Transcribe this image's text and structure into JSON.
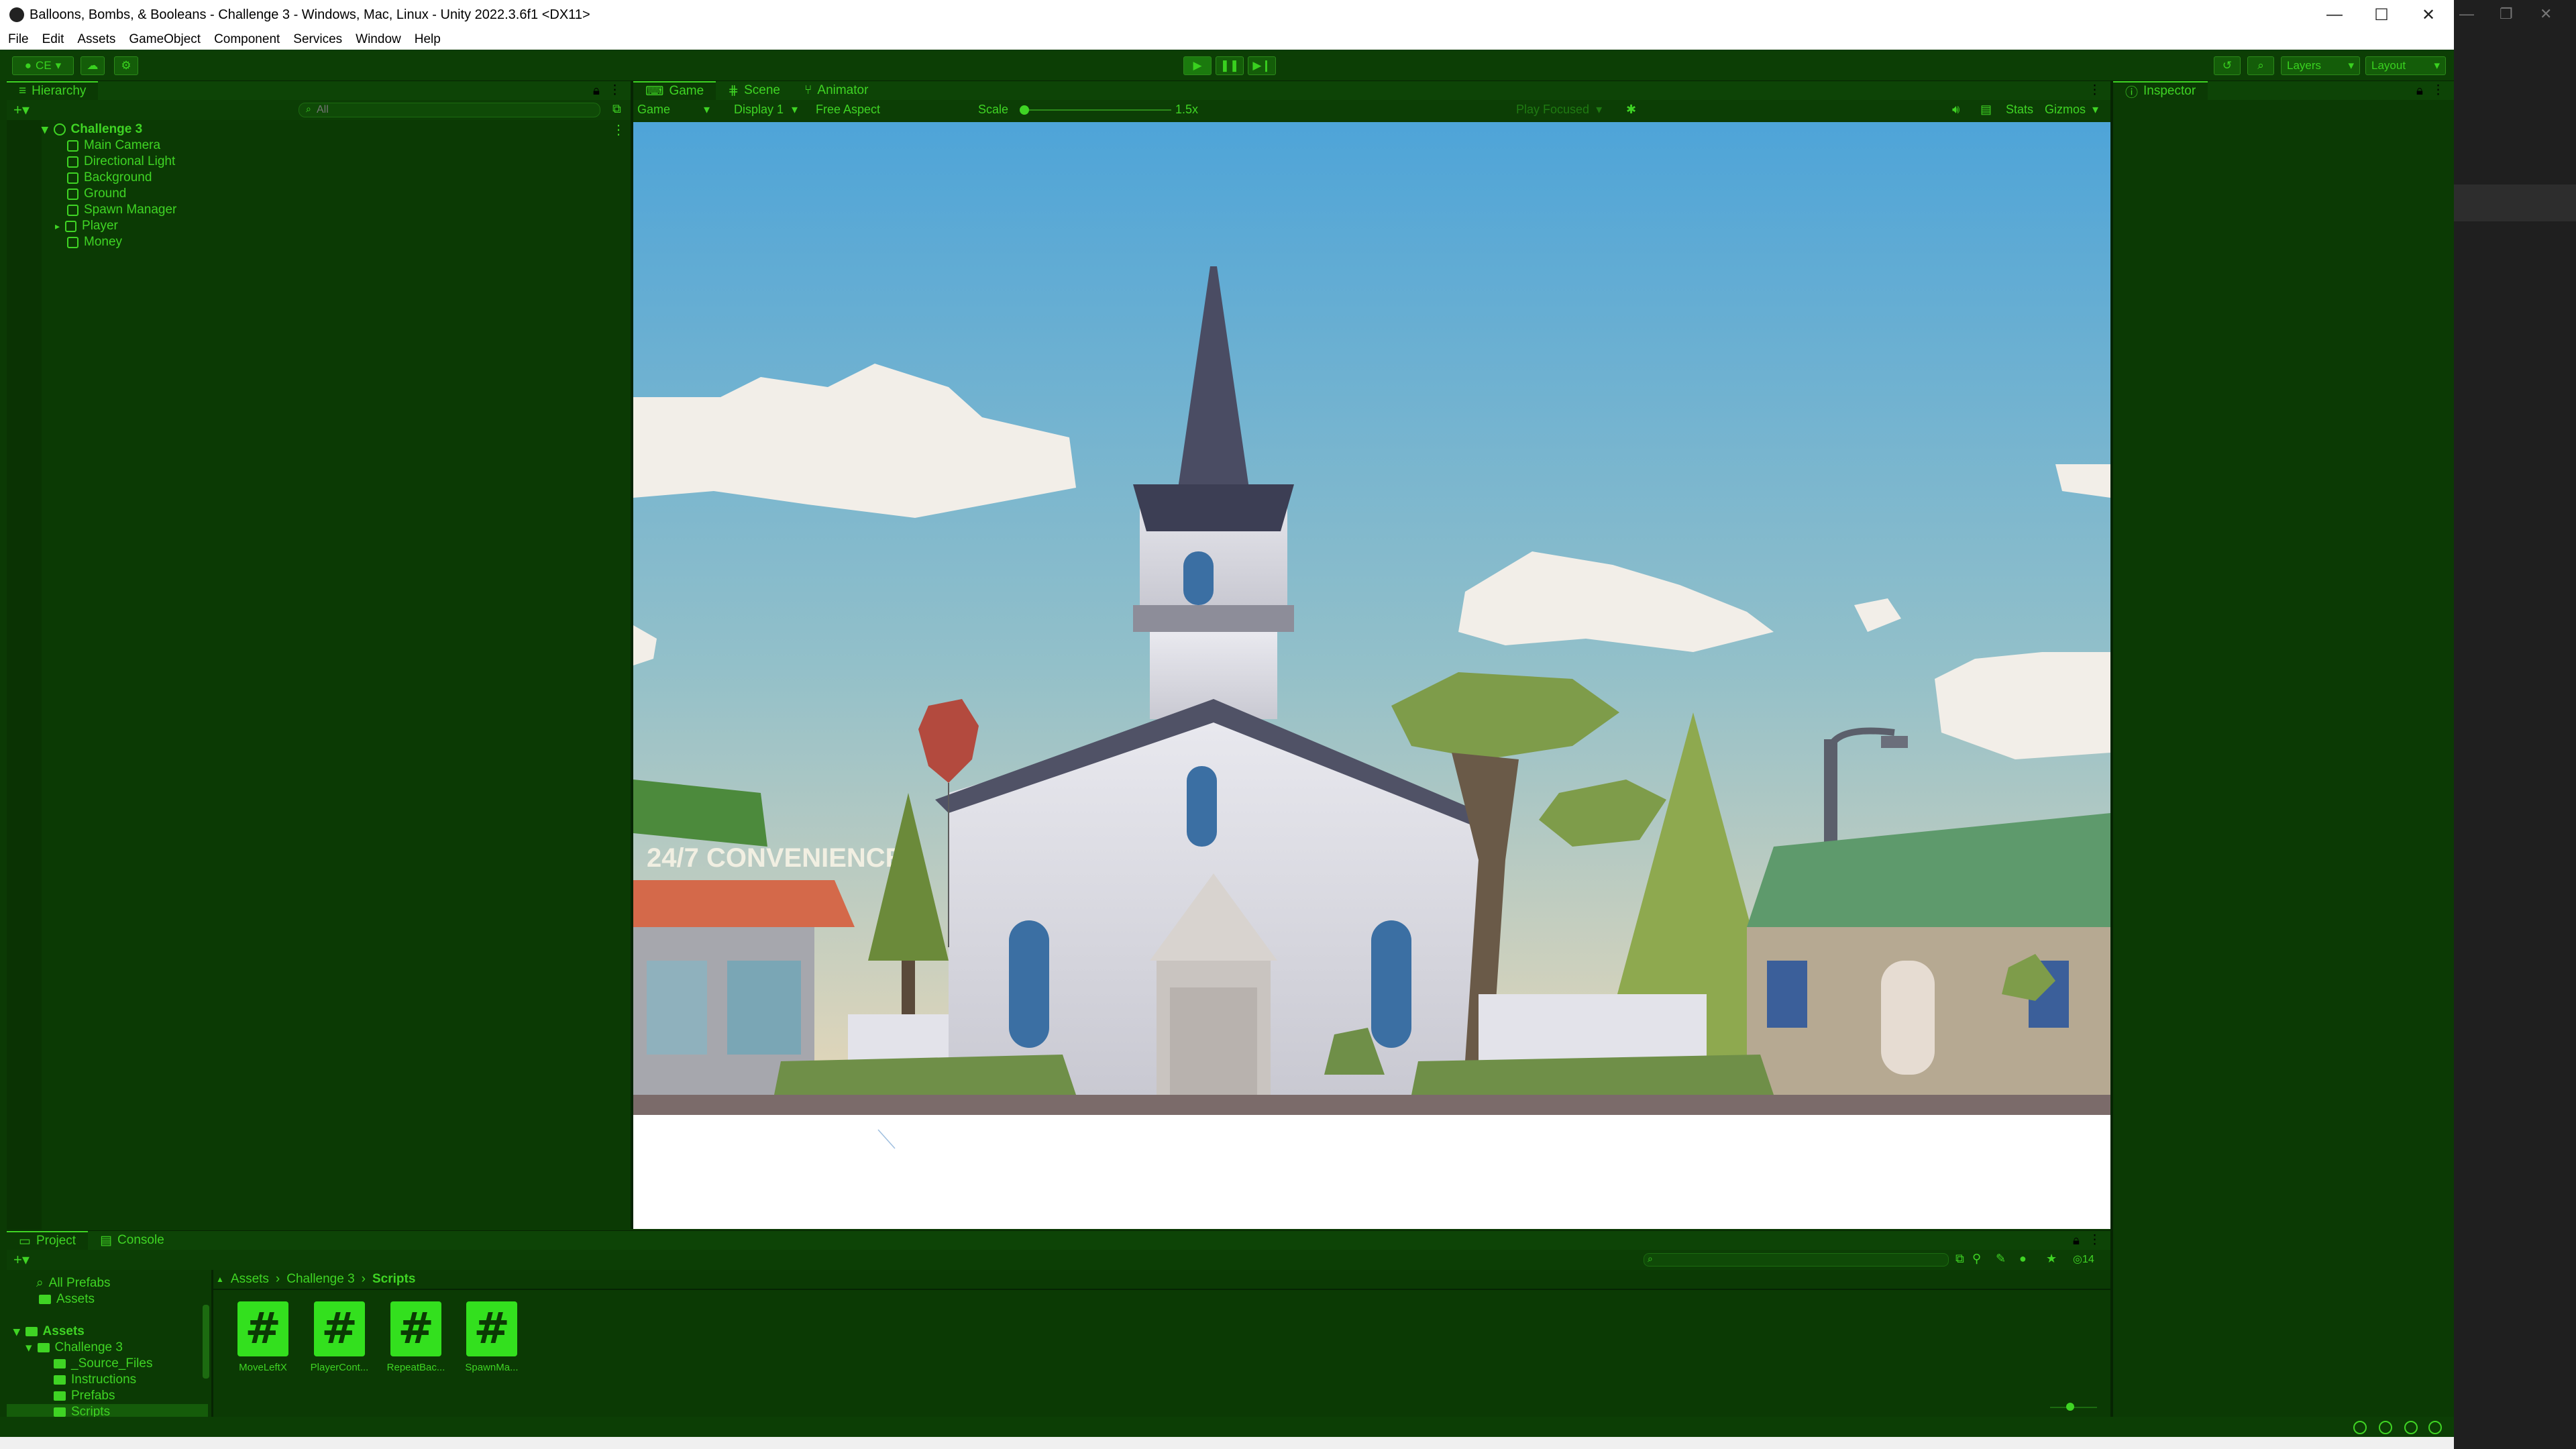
{
  "window": {
    "title": "Balloons, Bombs, & Booleans - Challenge 3 - Windows, Mac, Linux - Unity 2022.3.6f1 <DX11>",
    "controls": {
      "minimize": "—",
      "maximize": "☐",
      "close": "✕"
    }
  },
  "menu": [
    "File",
    "Edit",
    "Assets",
    "GameObject",
    "Component",
    "Services",
    "Window",
    "Help"
  ],
  "toolbar": {
    "account": "CE",
    "layers": "Layers",
    "layout": "Layout"
  },
  "hierarchy": {
    "tab": "Hierarchy",
    "search_placeholder": "All",
    "scene": "Challenge 3",
    "items": [
      "Main Camera",
      "Directional Light",
      "Background",
      "Ground",
      "Spawn Manager",
      "Player",
      "Money"
    ]
  },
  "game_panel": {
    "tabs": [
      "Game",
      "Scene",
      "Animator"
    ],
    "mode": "Game",
    "display": "Display 1",
    "aspect": "Free Aspect",
    "scale_label": "Scale",
    "scale_value": "1.5x",
    "play_mode": "Play Focused",
    "stats": "Stats",
    "gizmos": "Gizmos",
    "scene_sign": "24/7 CONVENIENCE"
  },
  "inspector": {
    "tab": "Inspector"
  },
  "project": {
    "tabs": [
      "Project",
      "Console"
    ],
    "favorites": [
      "All Prefabs",
      "Assets"
    ],
    "tree": {
      "root": "Assets",
      "child": "Challenge 3",
      "folders": [
        "_Source_Files",
        "Instructions",
        "Prefabs",
        "Scripts"
      ]
    },
    "breadcrumb": [
      "Assets",
      "Challenge 3",
      "Scripts"
    ],
    "scripts": [
      "MoveLeftX",
      "PlayerCont...",
      "RepeatBac...",
      "SpawnMa..."
    ],
    "hidden_count": "14"
  },
  "colors": {
    "panel_bg": "#0b3a04",
    "accent": "#3fd424",
    "sky_top": "#4ea4d8",
    "sky_bottom": "#e8d8b8"
  }
}
